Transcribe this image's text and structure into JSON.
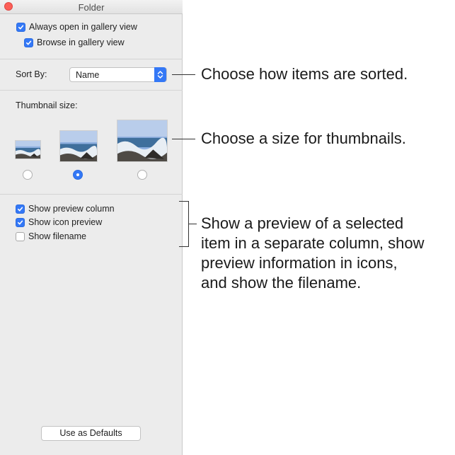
{
  "window": {
    "title": "Folder"
  },
  "gallery": {
    "always_open": {
      "label": "Always open in gallery view",
      "checked": true
    },
    "browse": {
      "label": "Browse in gallery view",
      "checked": true
    }
  },
  "sort": {
    "label": "Sort By:",
    "value": "Name"
  },
  "thumbnail": {
    "label": "Thumbnail size:",
    "options": [
      "small",
      "medium",
      "large"
    ],
    "selected": "medium"
  },
  "preview": {
    "show_preview_column": {
      "label": "Show preview column",
      "checked": true
    },
    "show_icon_preview": {
      "label": "Show icon preview",
      "checked": true
    },
    "show_filename": {
      "label": "Show filename",
      "checked": false
    }
  },
  "defaults_button": {
    "label": "Use as Defaults"
  },
  "callouts": {
    "sort": "Choose how items are sorted.",
    "thumbnail": "Choose a size for thumbnails.",
    "preview_lines": [
      "Show a preview of a selected",
      "item in a separate column, show",
      "preview information in icons,",
      "and show the filename."
    ]
  },
  "colors": {
    "accent": "#3478f6",
    "close": "#fc5f57",
    "panel": "#ececec"
  }
}
